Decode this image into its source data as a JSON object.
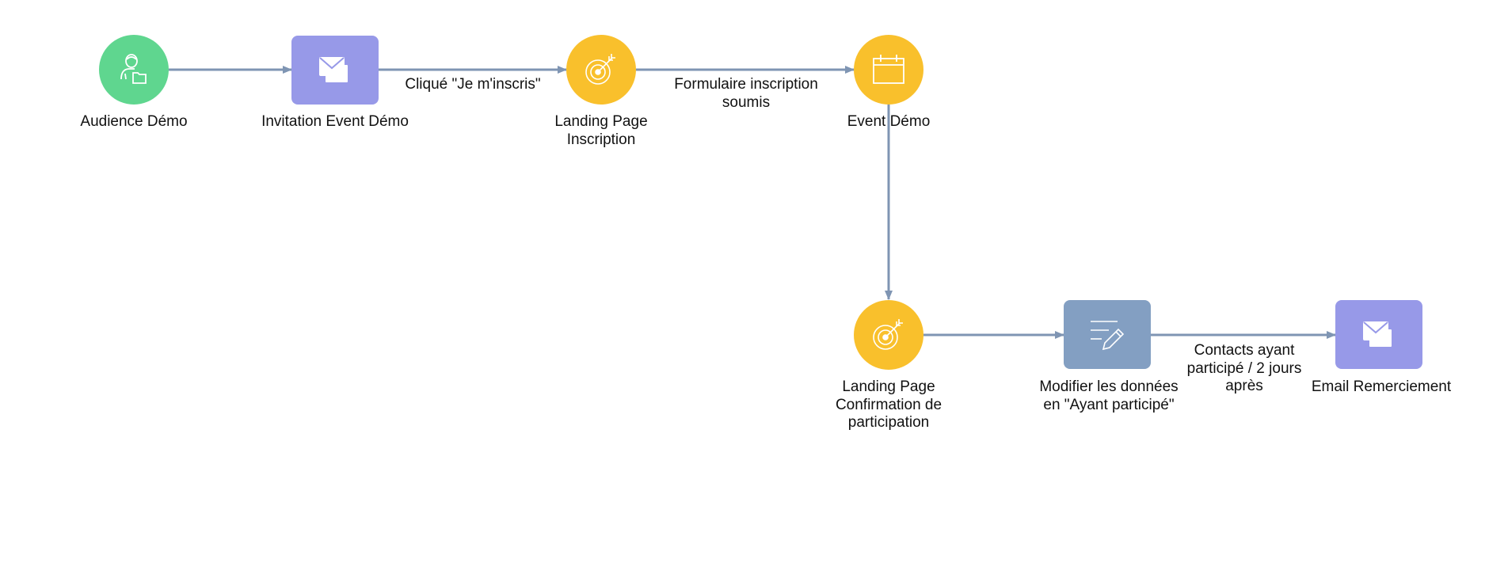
{
  "colors": {
    "audience": "#5fd68f",
    "email": "#9799e8",
    "landing": "#f9c02c",
    "event": "#f9c02c",
    "update": "#839fc2",
    "edge": "#7f95b3"
  },
  "nodes": [
    {
      "id": "audience",
      "label": "Audience Démo",
      "icon": "audience-icon"
    },
    {
      "id": "invitation",
      "label": "Invitation Event Démo",
      "icon": "email-icon"
    },
    {
      "id": "landing1",
      "label": "Landing Page\nInscription",
      "icon": "target-icon"
    },
    {
      "id": "event",
      "label": "Event Démo",
      "icon": "calendar-icon"
    },
    {
      "id": "landing2",
      "label": "Landing Page\nConfirmation de\nparticipation",
      "icon": "target-icon"
    },
    {
      "id": "modifier",
      "label": "Modifier les données\nen \"Ayant participé\"",
      "icon": "edit-data-icon"
    },
    {
      "id": "email2",
      "label": "Email Remerciement",
      "icon": "email-icon"
    }
  ],
  "edges": [
    {
      "from": "audience",
      "to": "invitation",
      "label": ""
    },
    {
      "from": "invitation",
      "to": "landing1",
      "label": "Cliqué \"Je m'inscris\""
    },
    {
      "from": "landing1",
      "to": "event",
      "label": "Formulaire inscription\nsoumis"
    },
    {
      "from": "event",
      "to": "landing2",
      "label": ""
    },
    {
      "from": "landing2",
      "to": "modifier",
      "label": ""
    },
    {
      "from": "modifier",
      "to": "email2",
      "label": "Contacts ayant\nparticipé / 2 jours\naprès"
    }
  ]
}
